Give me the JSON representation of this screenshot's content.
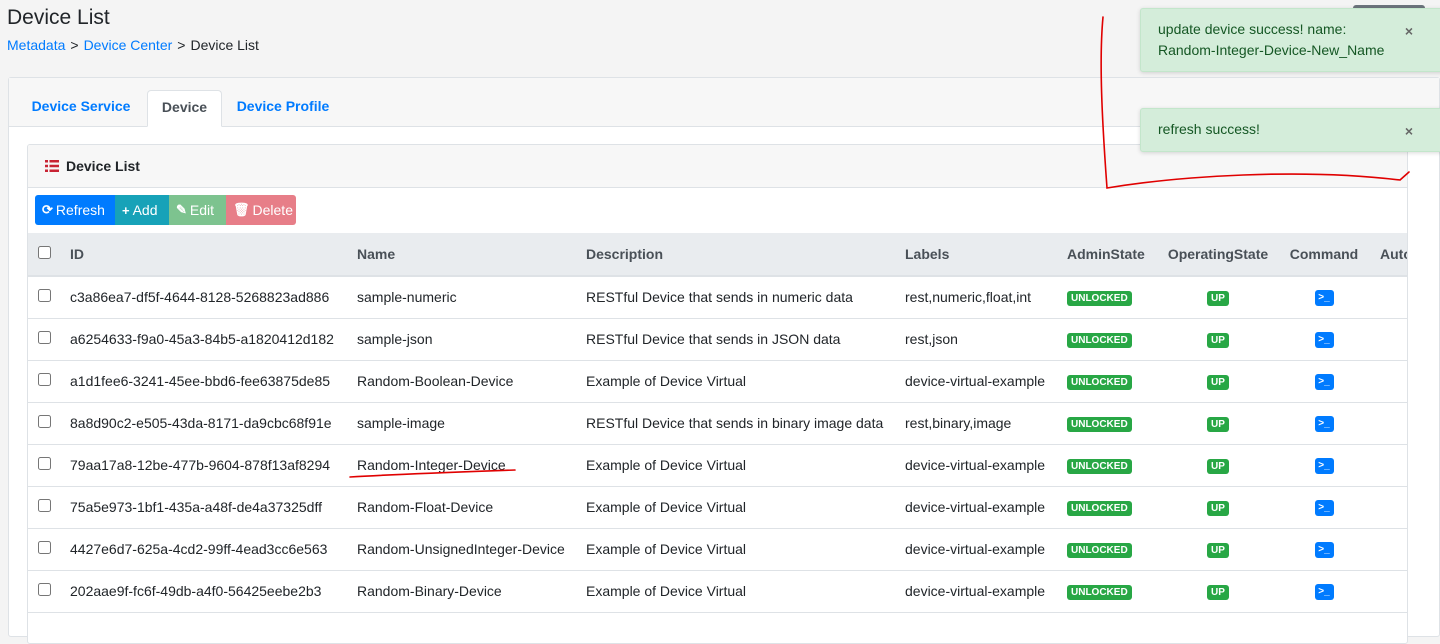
{
  "page": {
    "title": "Device List",
    "breadcrumb": [
      {
        "label": "Metadata",
        "link": true
      },
      {
        "label": "Device Center",
        "link": true
      },
      {
        "label": "Device List",
        "link": false
      }
    ]
  },
  "tabs": [
    {
      "label": "Device Service",
      "active": false
    },
    {
      "label": "Device",
      "active": true
    },
    {
      "label": "Device Profile",
      "active": false
    }
  ],
  "panel": {
    "title": "Device List",
    "icon": "list-icon"
  },
  "toolbar": {
    "refresh_label": "Refresh",
    "add_label": "Add",
    "edit_label": "Edit",
    "delete_label": "Delete"
  },
  "table": {
    "columns": [
      "ID",
      "Name",
      "Description",
      "Labels",
      "AdminState",
      "OperatingState",
      "Command",
      "Auto"
    ],
    "rows": [
      {
        "id": "c3a86ea7-df5f-4644-8128-5268823ad886",
        "name": "sample-numeric",
        "description": "RESTful Device that sends in numeric data",
        "labels": "rest,numeric,float,int",
        "admin": "UNLOCKED",
        "op": "UP"
      },
      {
        "id": "a6254633-f9a0-45a3-84b5-a1820412d182",
        "name": "sample-json",
        "description": "RESTful Device that sends in JSON data",
        "labels": "rest,json",
        "admin": "UNLOCKED",
        "op": "UP"
      },
      {
        "id": "a1d1fee6-3241-45ee-bbd6-fee63875de85",
        "name": "Random-Boolean-Device",
        "description": "Example of Device Virtual",
        "labels": "device-virtual-example",
        "admin": "UNLOCKED",
        "op": "UP"
      },
      {
        "id": "8a8d90c2-e505-43da-8171-da9cbc68f91e",
        "name": "sample-image",
        "description": "RESTful Device that sends in binary image data",
        "labels": "rest,binary,image",
        "admin": "UNLOCKED",
        "op": "UP"
      },
      {
        "id": "79aa17a8-12be-477b-9604-878f13af8294",
        "name": "Random-Integer-Device",
        "description": "Example of Device Virtual",
        "labels": "device-virtual-example",
        "admin": "UNLOCKED",
        "op": "UP"
      },
      {
        "id": "75a5e973-1bf1-435a-a48f-de4a37325dff",
        "name": "Random-Float-Device",
        "description": "Example of Device Virtual",
        "labels": "device-virtual-example",
        "admin": "UNLOCKED",
        "op": "UP"
      },
      {
        "id": "4427e6d7-625a-4cd2-99ff-4ead3cc6e563",
        "name": "Random-UnsignedInteger-Device",
        "description": "Example of Device Virtual",
        "labels": "device-virtual-example",
        "admin": "UNLOCKED",
        "op": "UP"
      },
      {
        "id": "202aae9f-fc6f-49db-a4f0-56425eebe2b3",
        "name": "Random-Binary-Device",
        "description": "Example of Device Virtual",
        "labels": "device-virtual-example",
        "admin": "UNLOCKED",
        "op": "UP"
      }
    ]
  },
  "toasts": [
    {
      "message": "update device success! name: Random-Integer-Device-New_Name",
      "close": "×"
    },
    {
      "message": "refresh success!",
      "close": "×"
    }
  ],
  "colors": {
    "primary": "#007bff",
    "info": "#17a2b8",
    "success": "#28a745",
    "annotation": "#e00000"
  }
}
